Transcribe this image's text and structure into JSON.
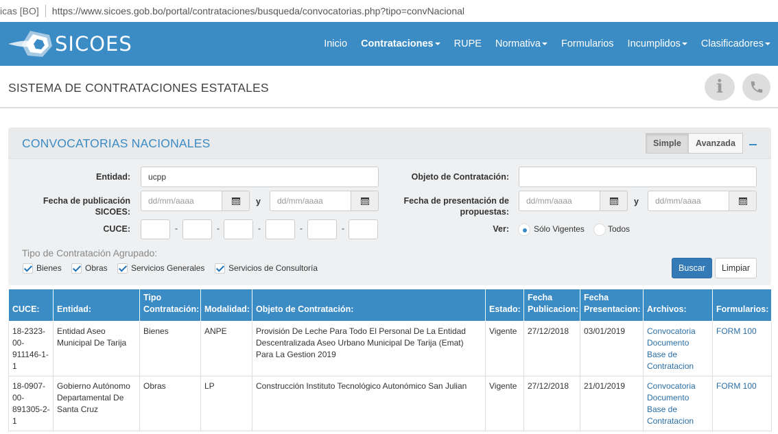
{
  "urlbar": {
    "site": "icas [BO]",
    "url": "https://www.sicoes.gob.bo/portal/contrataciones/busqueda/convocatorias.php?tipo=convNacional"
  },
  "brand": {
    "name": "SICOES",
    "color": "#3b8bc4",
    "logo_icon": "bolivia-shape-icon"
  },
  "nav": {
    "items": [
      {
        "label": "Inicio",
        "dropdown": false
      },
      {
        "label": "Contrataciones",
        "dropdown": true,
        "active": true
      },
      {
        "label": "RUPE",
        "dropdown": false
      },
      {
        "label": "Normativa",
        "dropdown": true
      },
      {
        "label": "Formularios",
        "dropdown": false
      },
      {
        "label": "Incumplidos",
        "dropdown": true
      },
      {
        "label": "Clasificadores",
        "dropdown": true
      }
    ]
  },
  "header": {
    "title": "SISTEMA DE CONTRATACIONES ESTATALES",
    "info_icon": "i",
    "phone_icon": "phone-icon"
  },
  "panel": {
    "title": "CONVOCATORIAS NACIONALES",
    "mode_simple": "Simple",
    "mode_advanced": "Avanzada",
    "entidad_label": "Entidad:",
    "entidad_value": "ucpp",
    "objeto_label": "Objeto de Contratación:",
    "objeto_value": "",
    "fecha_pub_label_1": "Fecha de publicación",
    "fecha_pub_label_2": "SICOES:",
    "fecha_pres_label_1": "Fecha de presentación de",
    "fecha_pres_label_2": "propuestas:",
    "date_placeholder": "dd/mm/aaaa",
    "and_label": "y",
    "cuce_label": "CUCE:",
    "cuce_sep": "-",
    "ver_label": "Ver:",
    "ver_options": [
      "Sólo Vigentes",
      "Todos"
    ],
    "ver_selected": "Sólo Vigentes",
    "tipo_label": "Tipo de Contratación Agrupado:",
    "tipo_options": [
      "Bienes",
      "Obras",
      "Servicios Generales",
      "Servicios de Consultoría"
    ],
    "search_button": "Buscar",
    "clear_button": "Limpiar"
  },
  "table": {
    "headers": {
      "cuce": "CUCE:",
      "entidad": "Entidad:",
      "tipo_1": "Tipo",
      "tipo_2": "Contratación:",
      "modalidad": "Modalidad:",
      "objeto": "Objeto de Contratación:",
      "estado": "Estado:",
      "fpub_1": "Fecha",
      "fpub_2": "Publicacion:",
      "fpres_1": "Fecha",
      "fpres_2": "Presentacion:",
      "archivos": "Archivos:",
      "formularios": "Formularios:"
    },
    "rows": [
      {
        "cuce": "18-2323-00-911146-1-1",
        "entidad": "Entidad Aseo Municipal De Tarija",
        "tipo": "Bienes",
        "modalidad": "ANPE",
        "objeto": "Provisión De Leche Para Todo El Personal De La Entidad Descentralizada Aseo Urbano Municipal De Tarija (Emat) Para La Gestion 2019",
        "estado": "Vigente",
        "fecha_pub": "27/12/2018",
        "fecha_pres": "03/01/2019",
        "archivo_1": "Convocatoria",
        "archivo_2": "Documento Base de Contratacion",
        "formulario": "FORM 100"
      },
      {
        "cuce": "18-0907-00-891305-2-1",
        "entidad": "Gobierno Autónomo Departamental De Santa Cruz",
        "tipo": "Obras",
        "modalidad": "LP",
        "objeto": "Construcción Instituto Tecnológico Autonómico San Julian",
        "estado": "Vigente",
        "fecha_pub": "27/12/2018",
        "fecha_pres": "21/01/2019",
        "archivo_1": "Convocatoria",
        "archivo_2": "Documento Base de Contratacion",
        "formulario": "FORM 100"
      }
    ]
  }
}
